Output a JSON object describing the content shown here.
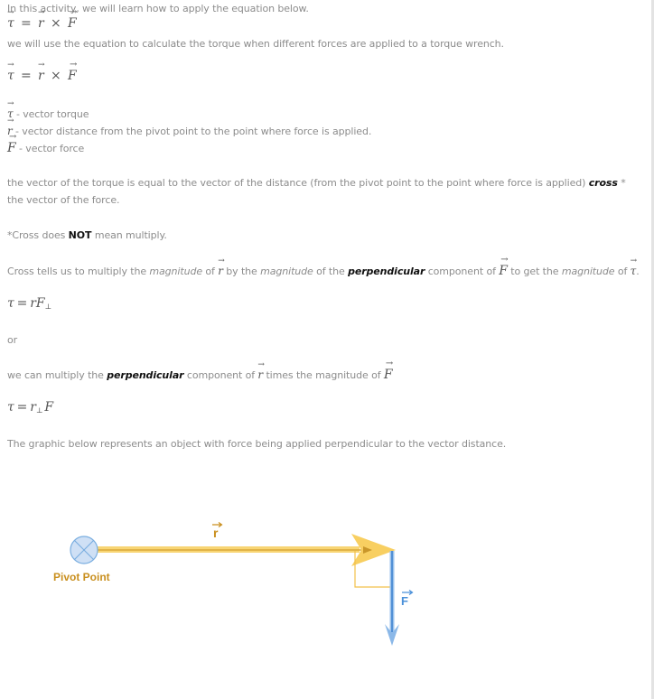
{
  "intro": "In this activity, we will learn how to apply the equation below.",
  "equation_main": {
    "tau": "τ",
    "eq": "=",
    "r": "r",
    "times": "×",
    "F": "F"
  },
  "usage": " we will use the equation to calculate the torque when different forces are applied to a torque wrench.",
  "definitions": [
    {
      "symbol": "τ",
      "text": " - vector torque"
    },
    {
      "symbol": "r",
      "text": " - vector distance from the pivot point to the point where force is applied."
    },
    {
      "symbol": "F",
      "text": " - vector force"
    }
  ],
  "cross_paragraph": {
    "before": "the vector of the torque is equal to the vector of the distance (from the pivot point to the point where force is applied) ",
    "bold": "cross",
    "after": " * the vector of the force."
  },
  "note": {
    "before": "*Cross does ",
    "bold": "NOT",
    "after": " mean multiply."
  },
  "cross_tells": {
    "p1": "Cross tells us to multiply the ",
    "m1": "magnitude",
    "p2": "  of ",
    "p3": " by the ",
    "m2": "magnitude",
    "p4": " of the ",
    "bold": "perpendicular",
    "p5": " component of ",
    "p6": " to get the ",
    "m3": "magnitude",
    "p7": " of ",
    "p8": "."
  },
  "equation_2": {
    "lhs": "τ",
    "eq": "=",
    "r": "r",
    "F": "F",
    "perp": "⊥"
  },
  "or": "or",
  "multiply_paragraph": {
    "p1": "we can multiply the ",
    "bold": "perpendicular",
    "p2": " component of ",
    "p3": " times the magnitude of "
  },
  "equation_3": {
    "lhs": "τ",
    "eq": "=",
    "r": "r",
    "perp": "⊥",
    "F": "F"
  },
  "graphic_caption": "The graphic below represents an object with force being applied perpendicular to the vector distance.",
  "diagram": {
    "pivot_label": "Pivot Point",
    "r_label": "r",
    "F_label": "F",
    "colors": {
      "r_vector": "#f5c842",
      "r_vector_dark": "#c9962a",
      "F_vector": "#4a90d9",
      "pivot_fill": "#cfe0f5",
      "pivot_stroke": "#7aaee0",
      "label_gold": "#c98f1e"
    }
  }
}
